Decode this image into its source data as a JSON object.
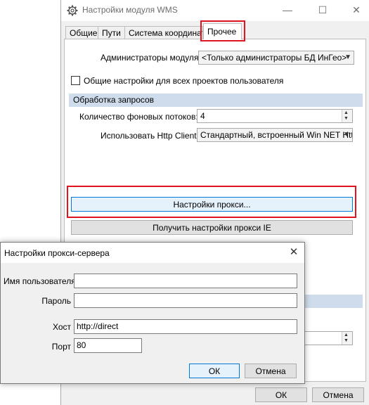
{
  "window": {
    "title": "Настройки модуля WMS",
    "controls": {
      "minimize": "—",
      "maximize": "☐",
      "close": "✕"
    }
  },
  "tabs": [
    {
      "label": "Общие"
    },
    {
      "label": "Пути"
    },
    {
      "label": "Система координат"
    },
    {
      "label": "Прочее"
    }
  ],
  "other": {
    "admins_label": "Администраторы модуля:",
    "admins_value": "<Только администраторы БД ИнГео>",
    "common_settings_label": "Общие настройки для всех проектов пользователя",
    "common_settings_checked": false,
    "requests_section": "Обработка запросов",
    "threads_label": "Количество фоновых потоков:",
    "threads_value": "4",
    "http_client_label": "Использовать Http Client:",
    "http_client_value": "Стандартный, встроенный Win NET Http",
    "proxy_settings_button": "Настройки прокси...",
    "get_ie_proxy_button": "Получить настройки прокси IE",
    "ok_button": "ОК",
    "cancel_button": "Отмена"
  },
  "proxy_dialog": {
    "title": "Настройки прокси-сервера",
    "close_glyph": "✕",
    "username_label": "Имя пользователя",
    "username_value": "",
    "password_label": "Пароль",
    "password_value": "",
    "host_label": "Хост",
    "host_value": "http://direct",
    "port_label": "Порт",
    "port_value": "80",
    "ok_button": "ОК",
    "cancel_button": "Отмена"
  },
  "colors": {
    "highlight_red": "#e0141e",
    "section_header_bg": "#cfdceb",
    "focus_blue": "#0078d7"
  }
}
